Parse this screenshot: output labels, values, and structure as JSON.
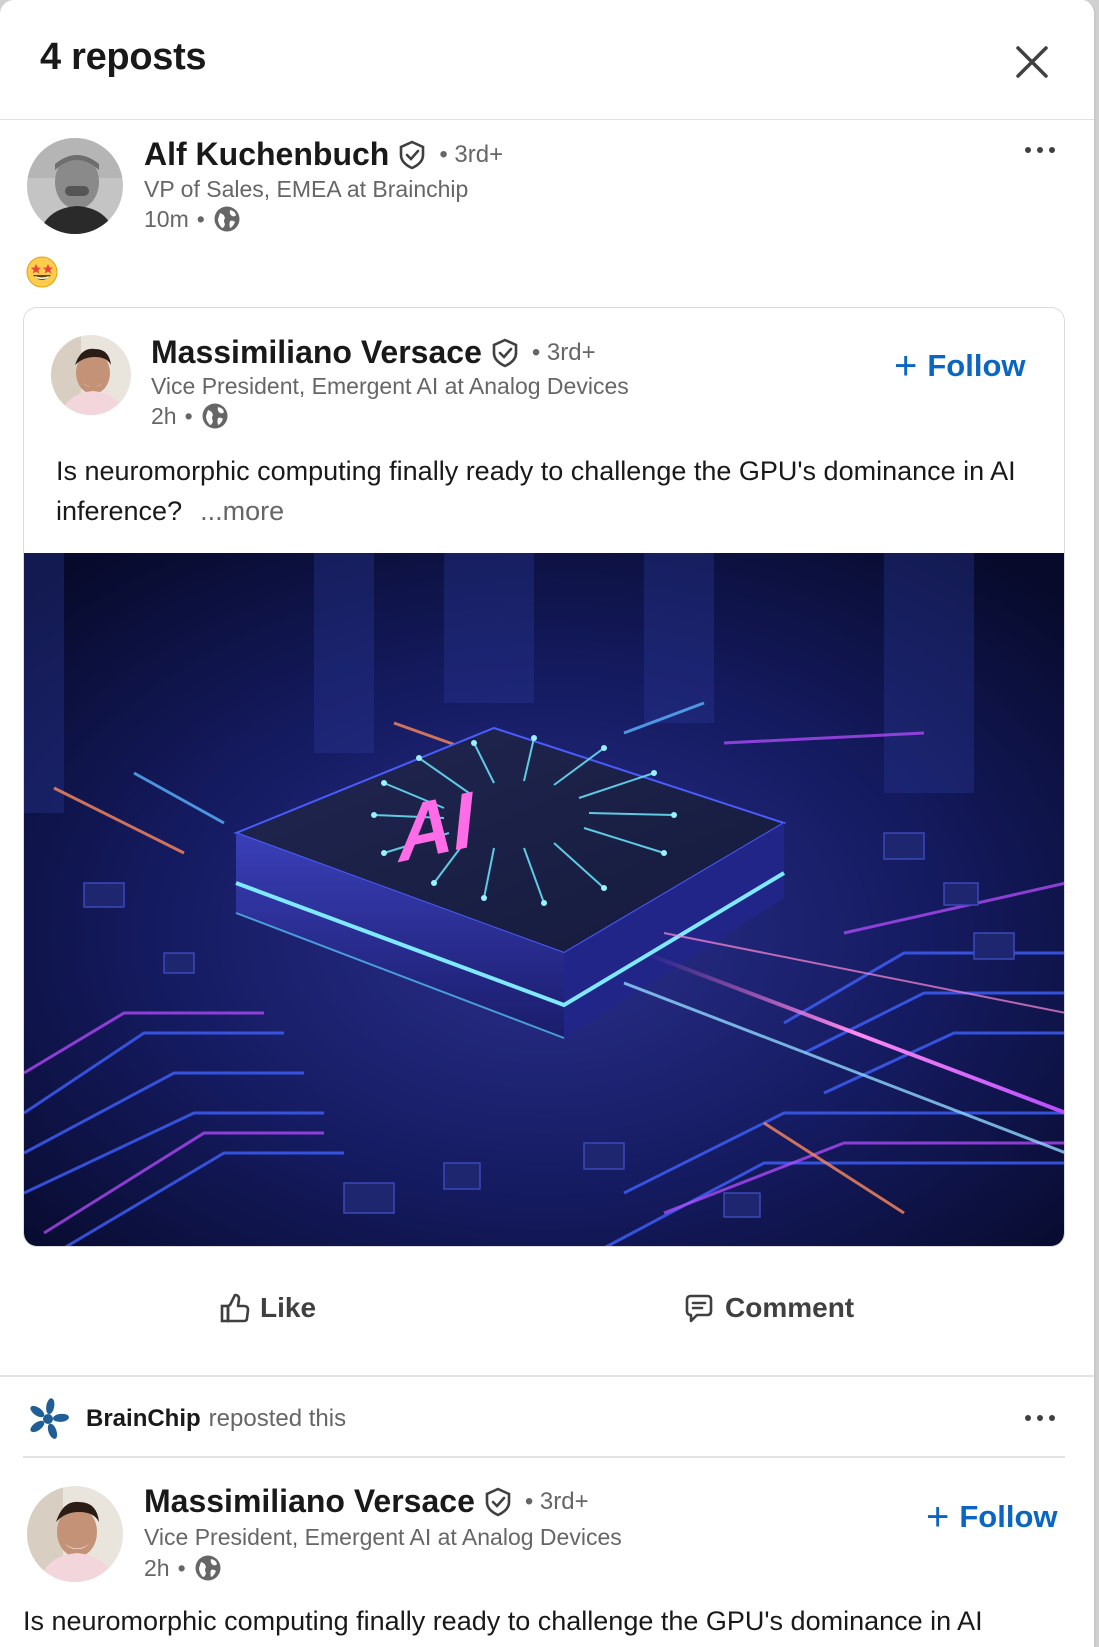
{
  "modal": {
    "title": "4 reposts",
    "close_icon": "close-icon"
  },
  "repost_1": {
    "author": {
      "name": "Alf Kuchenbuch",
      "degree": "• 3rd+",
      "headline": "VP of Sales, EMEA at Brainchip",
      "time": "10m",
      "visibility_icon": "globe-icon"
    },
    "more_icon": "more-icon",
    "reaction_emoji": "star-struck-emoji",
    "quoted_post": {
      "author": {
        "name": "Massimiliano Versace",
        "degree": "• 3rd+",
        "headline": "Vice President, Emergent AI at Analog Devices",
        "time": "2h",
        "visibility_icon": "globe-icon"
      },
      "follow_label": "Follow",
      "text": "Is neuromorphic computing finally ready to challenge the GPU's dominance in AI inference?",
      "see_more_label": "...more",
      "image_caption_text": "AI"
    },
    "actions": {
      "like_label": "Like",
      "comment_label": "Comment"
    }
  },
  "repost_2": {
    "reposter": {
      "name": "BrainChip",
      "action_text": "reposted this"
    },
    "more_icon": "more-icon",
    "author": {
      "name": "Massimiliano Versace",
      "degree": "• 3rd+",
      "headline": "Vice President, Emergent AI at Analog Devices",
      "time": "2h",
      "visibility_icon": "globe-icon"
    },
    "follow_label": "Follow",
    "text": "Is neuromorphic computing finally ready to challenge the GPU's dominance in AI"
  },
  "colors": {
    "link_blue": "#0a66c2",
    "muted_text": "#666666",
    "brainchip_logo": "#1f5f96"
  }
}
